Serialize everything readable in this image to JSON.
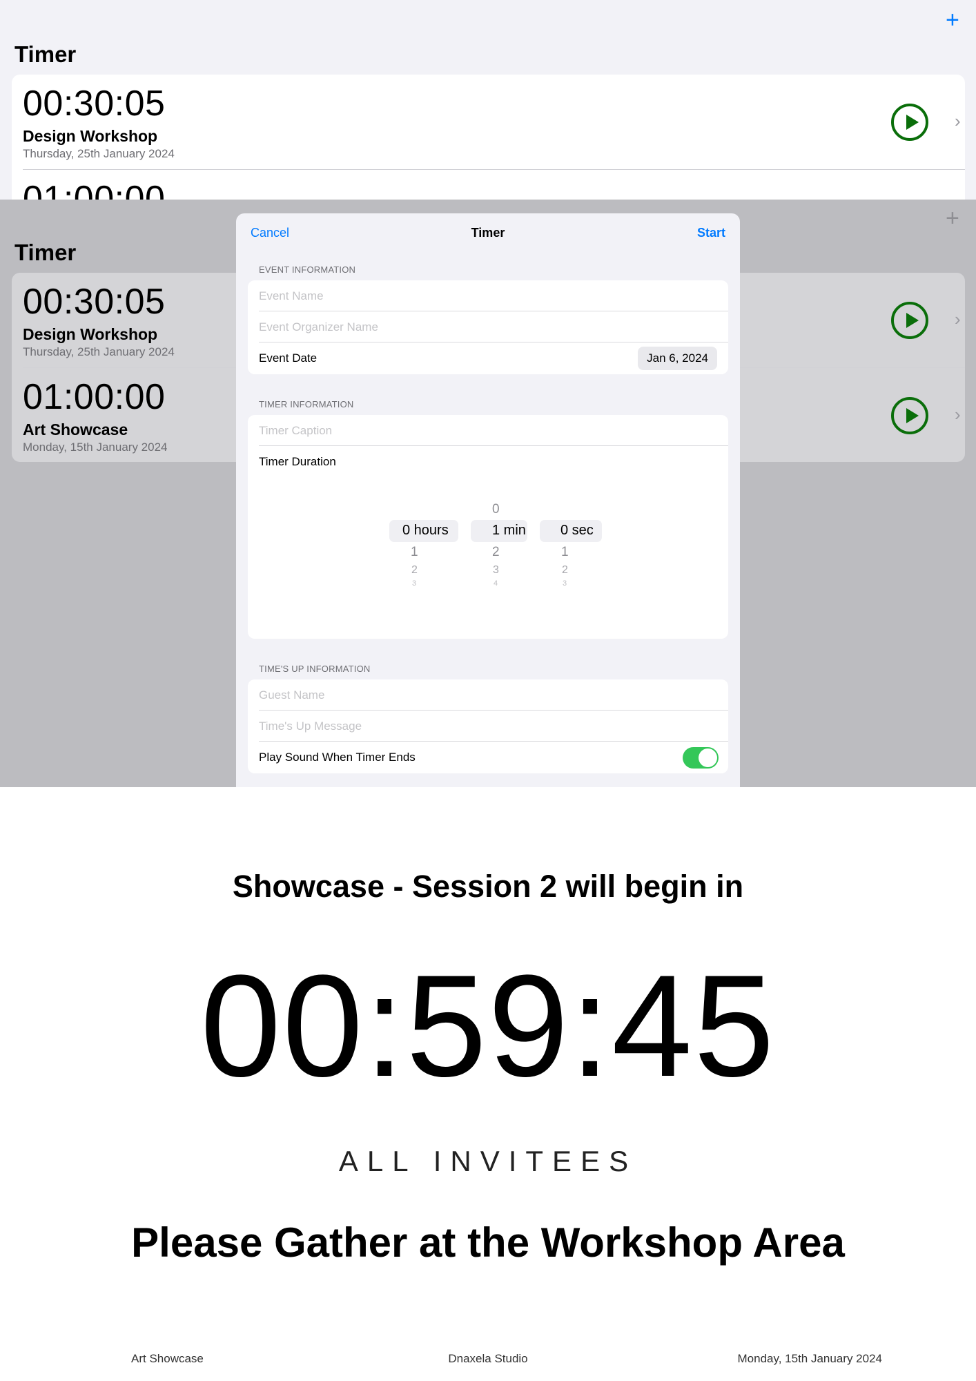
{
  "list_screen": {
    "title": "Timer",
    "add_icon": "plus-icon",
    "timers": [
      {
        "time": "00:30:05",
        "name": "Design Workshop",
        "date": "Thursday, 25th January 2024"
      },
      {
        "time": "01:00:00",
        "name": "Art Showcase",
        "date": "Monday, 15th January 2024"
      }
    ],
    "play_color": "#0a6e0a",
    "accent": "#007aff"
  },
  "new_timer_sheet": {
    "cancel": "Cancel",
    "title": "Timer",
    "start": "Start",
    "event_section": "EVENT INFORMATION",
    "event_name_placeholder": "Event Name",
    "organizer_placeholder": "Event Organizer Name",
    "event_date_label": "Event Date",
    "event_date_value": "Jan 6, 2024",
    "timer_section": "TIMER INFORMATION",
    "caption_placeholder": "Timer Caption",
    "duration_label": "Timer Duration",
    "picker": {
      "hours": {
        "selected": "0 hours",
        "below": [
          "1",
          "2",
          "3"
        ]
      },
      "minutes": {
        "above": "0",
        "selected": "1 min",
        "below": [
          "2",
          "3",
          "4"
        ]
      },
      "seconds": {
        "selected": "0 sec",
        "below": [
          "1",
          "2",
          "3"
        ]
      }
    },
    "timesup_section": "TIME'S UP INFORMATION",
    "guest_placeholder": "Guest Name",
    "message_placeholder": "Time's Up Message",
    "sound_label": "Play Sound When Timer Ends",
    "sound_on": true,
    "toggle_color": "#34c759"
  },
  "running_screen": {
    "headline": "Showcase - Session 2 will begin in",
    "countdown": "00:59:45",
    "guest": "ALL INVITEES",
    "message": "Please Gather at the Workshop Area",
    "footer_event": "Art Showcase",
    "footer_organizer": "Dnaxela Studio",
    "footer_date": "Monday, 15th January 2024"
  }
}
